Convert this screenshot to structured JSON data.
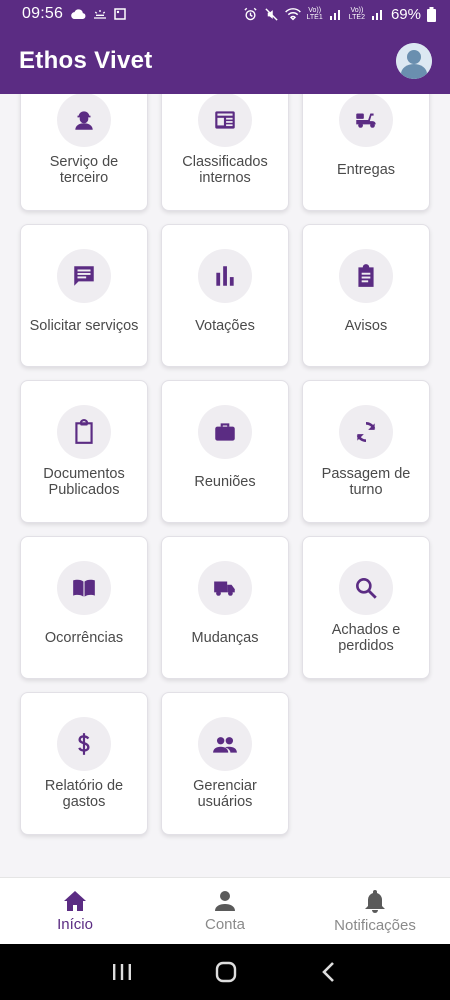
{
  "status_bar": {
    "time": "09:56",
    "battery": "69%",
    "lte1": "VoLTE1",
    "lte2": "VoLTE2"
  },
  "app_bar": {
    "title": "Ethos Vivet"
  },
  "cards": [
    {
      "label": "Serviço de\nterceiro",
      "icon": "worker-icon"
    },
    {
      "label": "Classificados\ninternos",
      "icon": "newspaper-icon"
    },
    {
      "label": "Entregas",
      "icon": "delivery-scooter-icon"
    },
    {
      "label": "Solicitar serviços",
      "icon": "chat-message-icon"
    },
    {
      "label": "Votações",
      "icon": "bar-chart-icon"
    },
    {
      "label": "Avisos",
      "icon": "clipboard-list-icon"
    },
    {
      "label": "Documentos\nPublicados",
      "icon": "clipboard-icon"
    },
    {
      "label": "Reuniões",
      "icon": "briefcase-icon"
    },
    {
      "label": "Passagem de\nturno",
      "icon": "sync-icon"
    },
    {
      "label": "Ocorrências",
      "icon": "open-book-icon"
    },
    {
      "label": "Mudanças",
      "icon": "truck-icon"
    },
    {
      "label": "Achados e\nperdidos",
      "icon": "search-icon"
    },
    {
      "label": "Relatório de\ngastos",
      "icon": "dollar-icon"
    },
    {
      "label": "Gerenciar\nusuários",
      "icon": "people-icon"
    }
  ],
  "bottom_nav": [
    {
      "label": "Início",
      "icon": "home-icon",
      "active": true
    },
    {
      "label": "Conta",
      "icon": "person-icon",
      "active": false
    },
    {
      "label": "Notificações",
      "icon": "bell-icon",
      "active": false
    }
  ],
  "colors": {
    "primary": "#5b2c83",
    "icon_bg": "#efedf1",
    "text": "#4a4a4a"
  }
}
